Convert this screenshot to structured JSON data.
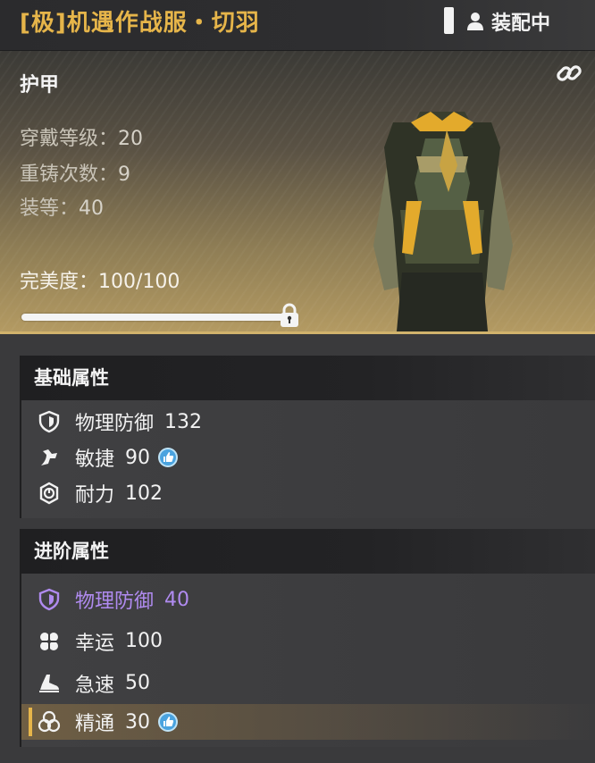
{
  "header": {
    "title": "[极]机遇作战服・切羽",
    "equip_status": "装配中"
  },
  "item": {
    "slot": "护甲",
    "stats": [
      {
        "label": "穿戴等级：",
        "value": "20"
      },
      {
        "label": "重铸次数：",
        "value": "9"
      },
      {
        "label": "装等：",
        "value": "40"
      }
    ],
    "perfection_label": "完美度：",
    "perfection_value": "100/100",
    "perfection_fraction": 1.0
  },
  "basic_attributes": {
    "title": "基础属性",
    "rows": [
      {
        "icon": "shield-icon",
        "name": "物理防御",
        "value": "132",
        "boosted": false
      },
      {
        "icon": "agility-icon",
        "name": "敏捷",
        "value": "90",
        "boosted": true
      },
      {
        "icon": "stamina-icon",
        "name": "耐力",
        "value": "102",
        "boosted": false
      }
    ]
  },
  "advanced_attributes": {
    "title": "进阶属性",
    "rows": [
      {
        "icon": "shield-icon",
        "name": "物理防御",
        "value": "40",
        "color": "#b08bf0"
      },
      {
        "icon": "clover-icon",
        "name": "幸运",
        "value": "100"
      },
      {
        "icon": "speed-shoe-icon",
        "name": "急速",
        "value": "50"
      },
      {
        "icon": "mastery-icon",
        "name": "精通",
        "value": "30",
        "boosted": true,
        "highlighted": true
      }
    ]
  },
  "colors": {
    "title_gold": "#e6b54a",
    "purple_attr": "#b08bf0",
    "boost_badge": "#4aa3df"
  }
}
